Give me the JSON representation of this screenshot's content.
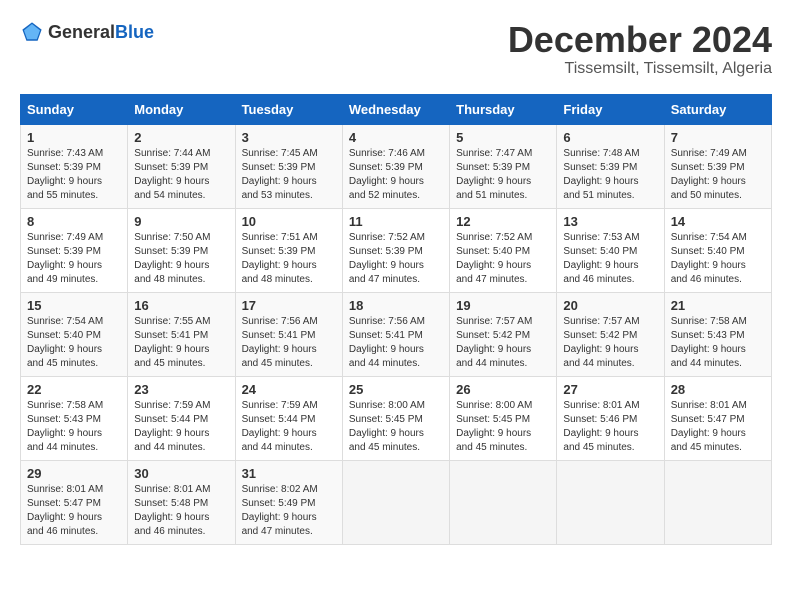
{
  "header": {
    "logo_general": "General",
    "logo_blue": "Blue",
    "month_title": "December 2024",
    "subtitle": "Tissemsilt, Tissemsilt, Algeria"
  },
  "calendar": {
    "days_of_week": [
      "Sunday",
      "Monday",
      "Tuesday",
      "Wednesday",
      "Thursday",
      "Friday",
      "Saturday"
    ],
    "weeks": [
      [
        null,
        null,
        null,
        null,
        null,
        null,
        null
      ],
      [
        null,
        null,
        null,
        null,
        null,
        null,
        null
      ],
      [
        null,
        null,
        null,
        null,
        null,
        null,
        null
      ],
      [
        null,
        null,
        null,
        null,
        null,
        null,
        null
      ],
      [
        null,
        null,
        null,
        null,
        null,
        null,
        null
      ]
    ],
    "cells": [
      {
        "day": 1,
        "sunrise": "7:43 AM",
        "sunset": "5:39 PM",
        "daylight": "9 hours and 55 minutes."
      },
      {
        "day": 2,
        "sunrise": "7:44 AM",
        "sunset": "5:39 PM",
        "daylight": "9 hours and 54 minutes."
      },
      {
        "day": 3,
        "sunrise": "7:45 AM",
        "sunset": "5:39 PM",
        "daylight": "9 hours and 53 minutes."
      },
      {
        "day": 4,
        "sunrise": "7:46 AM",
        "sunset": "5:39 PM",
        "daylight": "9 hours and 52 minutes."
      },
      {
        "day": 5,
        "sunrise": "7:47 AM",
        "sunset": "5:39 PM",
        "daylight": "9 hours and 51 minutes."
      },
      {
        "day": 6,
        "sunrise": "7:48 AM",
        "sunset": "5:39 PM",
        "daylight": "9 hours and 51 minutes."
      },
      {
        "day": 7,
        "sunrise": "7:49 AM",
        "sunset": "5:39 PM",
        "daylight": "9 hours and 50 minutes."
      },
      {
        "day": 8,
        "sunrise": "7:49 AM",
        "sunset": "5:39 PM",
        "daylight": "9 hours and 49 minutes."
      },
      {
        "day": 9,
        "sunrise": "7:50 AM",
        "sunset": "5:39 PM",
        "daylight": "9 hours and 48 minutes."
      },
      {
        "day": 10,
        "sunrise": "7:51 AM",
        "sunset": "5:39 PM",
        "daylight": "9 hours and 48 minutes."
      },
      {
        "day": 11,
        "sunrise": "7:52 AM",
        "sunset": "5:39 PM",
        "daylight": "9 hours and 47 minutes."
      },
      {
        "day": 12,
        "sunrise": "7:52 AM",
        "sunset": "5:40 PM",
        "daylight": "9 hours and 47 minutes."
      },
      {
        "day": 13,
        "sunrise": "7:53 AM",
        "sunset": "5:40 PM",
        "daylight": "9 hours and 46 minutes."
      },
      {
        "day": 14,
        "sunrise": "7:54 AM",
        "sunset": "5:40 PM",
        "daylight": "9 hours and 46 minutes."
      },
      {
        "day": 15,
        "sunrise": "7:54 AM",
        "sunset": "5:40 PM",
        "daylight": "9 hours and 45 minutes."
      },
      {
        "day": 16,
        "sunrise": "7:55 AM",
        "sunset": "5:41 PM",
        "daylight": "9 hours and 45 minutes."
      },
      {
        "day": 17,
        "sunrise": "7:56 AM",
        "sunset": "5:41 PM",
        "daylight": "9 hours and 45 minutes."
      },
      {
        "day": 18,
        "sunrise": "7:56 AM",
        "sunset": "5:41 PM",
        "daylight": "9 hours and 44 minutes."
      },
      {
        "day": 19,
        "sunrise": "7:57 AM",
        "sunset": "5:42 PM",
        "daylight": "9 hours and 44 minutes."
      },
      {
        "day": 20,
        "sunrise": "7:57 AM",
        "sunset": "5:42 PM",
        "daylight": "9 hours and 44 minutes."
      },
      {
        "day": 21,
        "sunrise": "7:58 AM",
        "sunset": "5:43 PM",
        "daylight": "9 hours and 44 minutes."
      },
      {
        "day": 22,
        "sunrise": "7:58 AM",
        "sunset": "5:43 PM",
        "daylight": "9 hours and 44 minutes."
      },
      {
        "day": 23,
        "sunrise": "7:59 AM",
        "sunset": "5:44 PM",
        "daylight": "9 hours and 44 minutes."
      },
      {
        "day": 24,
        "sunrise": "7:59 AM",
        "sunset": "5:44 PM",
        "daylight": "9 hours and 44 minutes."
      },
      {
        "day": 25,
        "sunrise": "8:00 AM",
        "sunset": "5:45 PM",
        "daylight": "9 hours and 45 minutes."
      },
      {
        "day": 26,
        "sunrise": "8:00 AM",
        "sunset": "5:45 PM",
        "daylight": "9 hours and 45 minutes."
      },
      {
        "day": 27,
        "sunrise": "8:01 AM",
        "sunset": "5:46 PM",
        "daylight": "9 hours and 45 minutes."
      },
      {
        "day": 28,
        "sunrise": "8:01 AM",
        "sunset": "5:47 PM",
        "daylight": "9 hours and 45 minutes."
      },
      {
        "day": 29,
        "sunrise": "8:01 AM",
        "sunset": "5:47 PM",
        "daylight": "9 hours and 46 minutes."
      },
      {
        "day": 30,
        "sunrise": "8:01 AM",
        "sunset": "5:48 PM",
        "daylight": "9 hours and 46 minutes."
      },
      {
        "day": 31,
        "sunrise": "8:02 AM",
        "sunset": "5:49 PM",
        "daylight": "9 hours and 47 minutes."
      }
    ]
  }
}
